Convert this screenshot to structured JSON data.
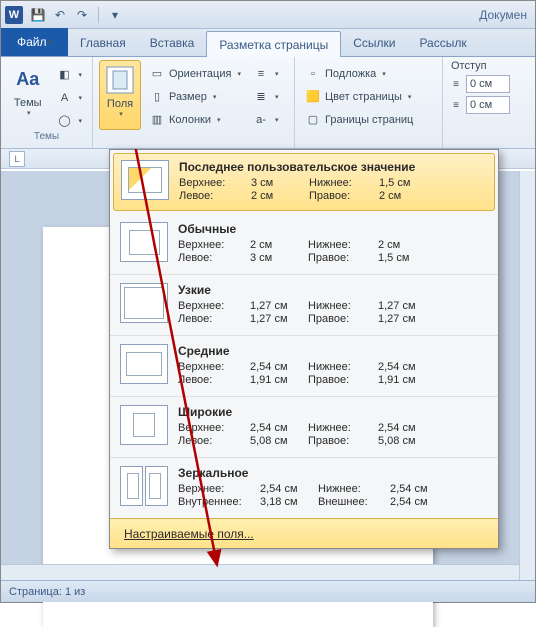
{
  "title": "Докумен",
  "tabs": {
    "file": "Файл",
    "home": "Главная",
    "insert": "Вставка",
    "layout": "Разметка страницы",
    "references": "Ссылки",
    "mailings": "Рассылк"
  },
  "ribbon": {
    "themes_group": "Темы",
    "themes_btn": "Темы",
    "margins_btn": "Поля",
    "orientation": "Ориентация",
    "size": "Размер",
    "columns": "Колонки",
    "watermark": "Подложка",
    "page_color": "Цвет страницы",
    "page_borders": "Границы страниц",
    "indent_label": "Отступ",
    "indent_left": "0 см",
    "indent_right": "0 см"
  },
  "margins": {
    "last": {
      "title": "Последнее пользовательское значение",
      "top_l": "Верхнее:",
      "top_v": "3 см",
      "bottom_l": "Нижнее:",
      "bottom_v": "1,5 см",
      "left_l": "Левое:",
      "left_v": "2 см",
      "right_l": "Правое:",
      "right_v": "2 см"
    },
    "normal": {
      "title": "Обычные",
      "top_l": "Верхнее:",
      "top_v": "2 см",
      "bottom_l": "Нижнее:",
      "bottom_v": "2 см",
      "left_l": "Левое:",
      "left_v": "3 см",
      "right_l": "Правое:",
      "right_v": "1,5 см"
    },
    "narrow": {
      "title": "Узкие",
      "top_l": "Верхнее:",
      "top_v": "1,27 см",
      "bottom_l": "Нижнее:",
      "bottom_v": "1,27 см",
      "left_l": "Левое:",
      "left_v": "1,27 см",
      "right_l": "Правое:",
      "right_v": "1,27 см"
    },
    "moderate": {
      "title": "Средние",
      "top_l": "Верхнее:",
      "top_v": "2,54 см",
      "bottom_l": "Нижнее:",
      "bottom_v": "2,54 см",
      "left_l": "Левое:",
      "left_v": "1,91 см",
      "right_l": "Правое:",
      "right_v": "1,91 см"
    },
    "wide": {
      "title": "Широкие",
      "top_l": "Верхнее:",
      "top_v": "2,54 см",
      "bottom_l": "Нижнее:",
      "bottom_v": "2,54 см",
      "left_l": "Левое:",
      "left_v": "5,08 см",
      "right_l": "Правое:",
      "right_v": "5,08 см"
    },
    "mirrored": {
      "title": "Зеркальное",
      "top_l": "Верхнее:",
      "top_v": "2,54 см",
      "bottom_l": "Нижнее:",
      "bottom_v": "2,54 см",
      "left_l": "Внутреннее:",
      "left_v": "3,18 см",
      "right_l": "Внешнее:",
      "right_v": "2,54 см"
    },
    "custom": "Настраиваемые поля..."
  },
  "status": "Страница: 1 из"
}
